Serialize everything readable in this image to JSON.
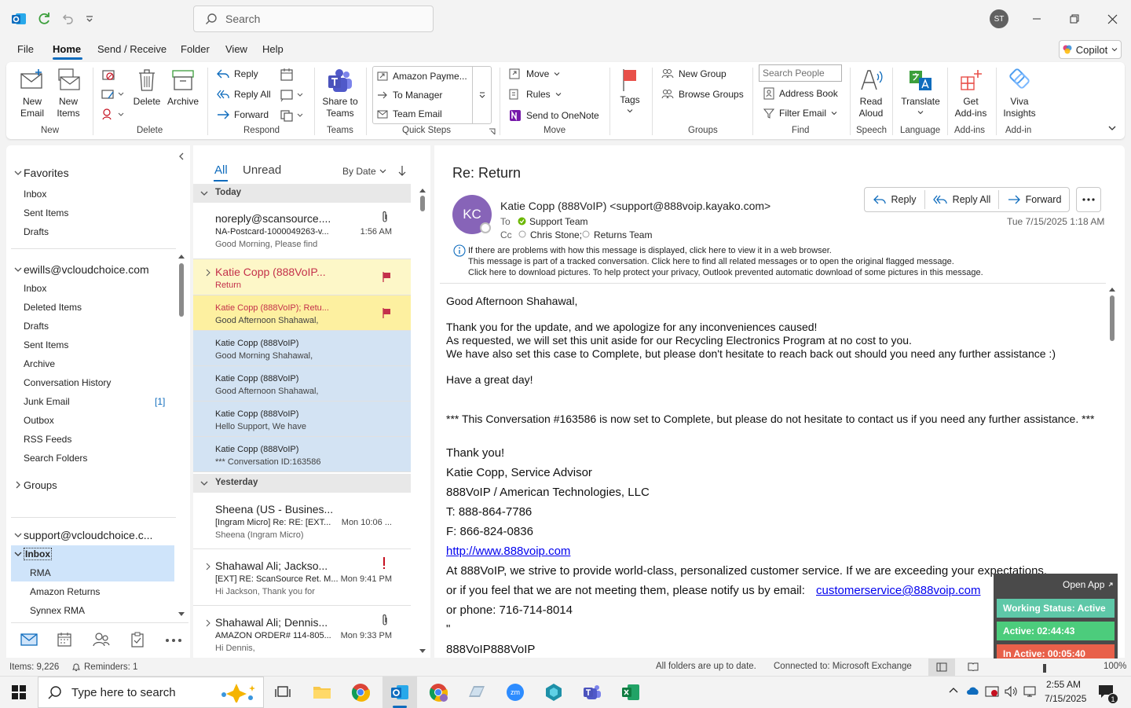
{
  "titlebar": {
    "search_placeholder": "Search",
    "avatar_initials": "ST"
  },
  "menu": {
    "items": [
      "File",
      "Home",
      "Send / Receive",
      "Folder",
      "View",
      "Help"
    ],
    "active": "Home",
    "copilot": "Copilot"
  },
  "ribbon": {
    "new_email": [
      "New",
      "Email"
    ],
    "new_items": [
      "New",
      "Items"
    ],
    "delete": "Delete",
    "archive": "Archive",
    "reply": "Reply",
    "reply_all": "Reply All",
    "forward": "Forward",
    "share_to_teams": [
      "Share to",
      "Teams"
    ],
    "quick_steps": [
      "Amazon Payme...",
      "To Manager",
      "Team Email"
    ],
    "move": "Move",
    "rules": "Rules",
    "send_to_onenote": "Send to OneNote",
    "tags": "Tags",
    "new_group": "New Group",
    "browse_groups": "Browse Groups",
    "search_people_placeholder": "Search People",
    "address_book": "Address Book",
    "filter_email": "Filter Email",
    "read_aloud": [
      "Read",
      "Aloud"
    ],
    "translate": "Translate",
    "get_addins": [
      "Get",
      "Add-ins"
    ],
    "viva_insights": [
      "Viva",
      "Insights"
    ],
    "groups": [
      "New",
      "Delete",
      "Respond",
      "Teams",
      "Quick Steps",
      "Move",
      "Groups",
      "Find",
      "Speech",
      "Language",
      "Add-ins",
      "Add-in"
    ]
  },
  "folders": {
    "favorites_title": "Favorites",
    "favorites": [
      "Inbox",
      "Sent Items",
      "Drafts"
    ],
    "account1": "ewills@vcloudchoice.com",
    "account1_items": [
      "Inbox",
      "Deleted Items",
      "Drafts",
      "Sent Items",
      "Archive",
      "Conversation History",
      "Junk Email",
      "Outbox",
      "RSS Feeds",
      "Search Folders"
    ],
    "junk_count": "[1]",
    "groups": "Groups",
    "account2": "support@vcloudchoice.c...",
    "account2_items": [
      "Inbox",
      "RMA",
      "Amazon Returns",
      "Synnex RMA"
    ]
  },
  "list": {
    "tab_all": "All",
    "tab_unread": "Unread",
    "sort": "By Date",
    "today": "Today",
    "yesterday": "Yesterday",
    "messages": [
      {
        "from": "noreply@scansource....",
        "subject": "NA-Postcard-1000049263-v...",
        "preview": "Good Morning, Please find",
        "time": "1:56 AM"
      },
      {
        "from": "Katie Copp (888VoIP...",
        "subject": "Return"
      },
      {
        "from": "Katie Copp (888VoIP);  Retu...",
        "preview": "Good Afternoon Shahawal,"
      },
      {
        "from": "Katie Copp (888VoIP)",
        "preview": "Good Morning Shahawal,"
      },
      {
        "from": "Katie Copp (888VoIP)",
        "preview": "Good Afternoon Shahawal,"
      },
      {
        "from": "Katie Copp (888VoIP)",
        "preview": "Hello Support,  We have"
      },
      {
        "from": "Katie Copp (888VoIP)",
        "preview": "*** Conversation ID:163586"
      },
      {
        "from": "Sheena (US - Busines...",
        "subject": "[Ingram Micro] Re: RE: [EXT...",
        "preview": "Sheena (Ingram Micro)",
        "time": "Mon 10:06 ..."
      },
      {
        "from": "Shahawal Ali;  Jackso...",
        "subject": "[EXT] RE: ScanSource Ret. M...",
        "preview": "Hi Jackson,  Thank you for",
        "time": "Mon 9:41 PM"
      },
      {
        "from": "Shahawal Ali;  Dennis...",
        "subject": "AMAZON ORDER# 114-805...",
        "preview": "Hi Dennis,",
        "time": "Mon 9:33 PM"
      }
    ]
  },
  "reading": {
    "subject": "Re: Return",
    "avatar": "KC",
    "from": "Katie Copp (888VoIP) <support@888voip.kayako.com>",
    "to_label": "To",
    "to": "Support Team",
    "cc_label": "Cc",
    "cc1": "Chris Stone;",
    "cc2": "Returns Team",
    "date": "Tue 7/15/2025 1:18 AM",
    "reply": "Reply",
    "reply_all": "Reply All",
    "forward": "Forward",
    "info": [
      "If there are problems with how this message is displayed, click here to view it in a web browser.",
      "This message is part of a tracked conversation. Click here to find all related messages or to open the original flagged message.",
      "Click here to download pictures. To help protect your privacy, Outlook prevented automatic download of some pictures in this message."
    ],
    "body": {
      "greeting": "Good Afternoon Shahawal,",
      "p1": "Thank you for the update, and we apologize for any inconveniences caused!",
      "p2": "As requested, we will set this unit aside for our Recycling Electronics Program at no cost to you.",
      "p3": "We have also set this case to Complete, but please don't hesitate to reach back out should you need any further assistance :)",
      "p4": "Have a great day!",
      "p5": "*** This Conversation #163586 is now set to Complete, but please do not hesitate to contact us if you need any further assistance. ***",
      "p6": "Thank you!",
      "sig1": "Katie Copp, Service Advisor",
      "sig2": "888VoIP / American Technologies, LLC",
      "sig3": "T: 888-864-7786",
      "sig4": "F: 866-824-0836",
      "link": "http://www.888voip.com",
      "p7": "At 888VoIP, we strive to provide world-class, personalized customer service. If we are exceeding your expectations,",
      "p8a": "or if you feel that we are not meeting them, please notify us by email:",
      "email": "customerservice@888voip.com",
      "p9": "or phone: 716-714-8014",
      "p10": "\"",
      "p11": "888VoIP888VoIP"
    }
  },
  "status": {
    "items": "Items: 9,226",
    "reminders": "Reminders: 1",
    "uptodate": "All folders are up to date.",
    "connected": "Connected to: Microsoft Exchange",
    "zoom": "100%"
  },
  "widget": {
    "open_app": "Open App",
    "working": "Working Status: Active",
    "active": "Active: 02:44:43",
    "inactive": "In Active: 00:05:40"
  },
  "taskbar": {
    "search_placeholder": "Type here to search",
    "time": "2:55 AM",
    "date": "7/15/2025",
    "notif_count": "1"
  }
}
